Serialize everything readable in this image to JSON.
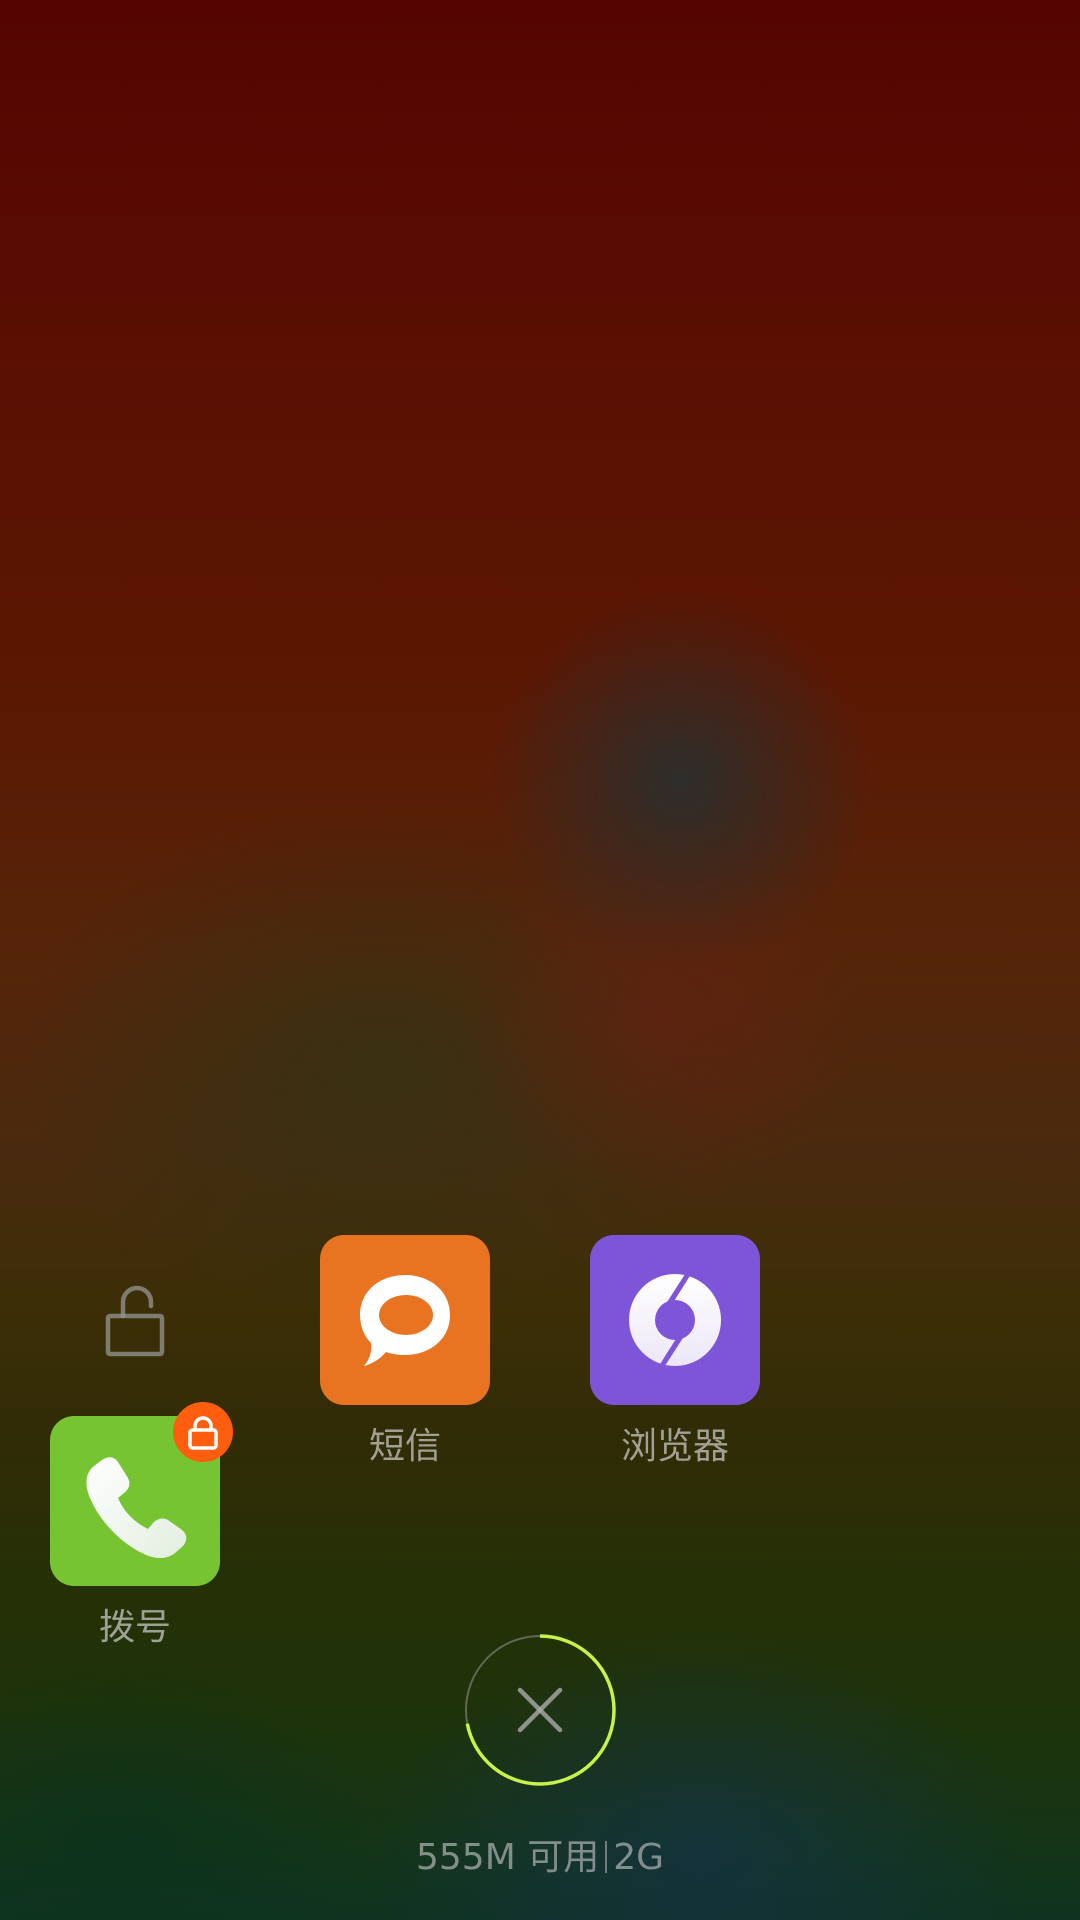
{
  "apps": [
    {
      "label": "拨号",
      "icon": "phone-icon",
      "color": "#76c431",
      "locked": true,
      "badge_color": "#ff5e0e"
    },
    {
      "label": "短信",
      "icon": "message-bubble-icon",
      "color": "#e87321",
      "locked": false
    },
    {
      "label": "浏览器",
      "icon": "browser-icon",
      "color": "#7e55d9",
      "locked": false
    }
  ],
  "lock_toggle": {
    "icon": "unlock-icon"
  },
  "clear_button": {
    "icon": "close-icon",
    "ring_color": "#c7f24a",
    "memory_used_fraction": 0.72
  },
  "memory": {
    "available": "555M 可用",
    "total": "2G"
  }
}
